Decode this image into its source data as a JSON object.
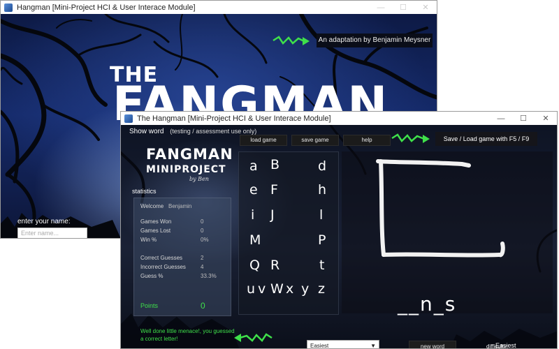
{
  "back_window": {
    "title": "Hangman [Mini-Project HCI & User Interace Module]",
    "min_icon": "—",
    "max_icon": "☐",
    "close_icon": "✕",
    "logo_the": "THE",
    "logo_fangman": "FANGMAN",
    "credit": "An adaptation by Benjamin Meysner",
    "name_label": "enter your name:",
    "name_placeholder": "Enter name..."
  },
  "front_window": {
    "title": "The Hangman [Mini-Project HCI & User Interace Module]",
    "min_icon": "—",
    "max_icon": "☐",
    "close_icon": "✕",
    "show_word": "Show word",
    "show_word_note": "(testing / assessment use only)",
    "menu": {
      "load": "load game",
      "save": "save game",
      "help": "help"
    },
    "save_note": "Save / Load game with F5 / F9",
    "logo_line1": "FANGMAN",
    "logo_line2": "MINIPROJECT",
    "logo_line3": "by Ben",
    "statistics_label": "statistics",
    "stats": {
      "welcome_label": "Welcome",
      "welcome_name": "Benjamin",
      "games_won_label": "Games Won",
      "games_won": "0",
      "games_lost_label": "Games Lost",
      "games_lost": "0",
      "win_pct_label": "Win %",
      "win_pct": "0%",
      "correct_label": "Correct Guesses",
      "correct": "2",
      "incorrect_label": "Incorrect Guesses",
      "incorrect": "4",
      "guess_pct_label": "Guess %",
      "guess_pct": "33.3%",
      "points_label": "Points",
      "points": "0"
    },
    "letters": [
      "a",
      "B",
      "d",
      "e",
      "F",
      "h",
      "i",
      "J",
      "l",
      "M",
      "P",
      "Q",
      "R",
      "t",
      "u",
      "v",
      "W",
      "x",
      "y",
      "z"
    ],
    "word": "__n_s",
    "feedback": "Well done little menace!, you guessed a correct letter!",
    "difficulty_select": "Easiest",
    "new_word": "new word",
    "difficulty_label": "difficulty:",
    "difficulty_value": "Easiest"
  },
  "colors": {
    "accent_green": "#3fe04a",
    "panel": "#3c4b64"
  }
}
